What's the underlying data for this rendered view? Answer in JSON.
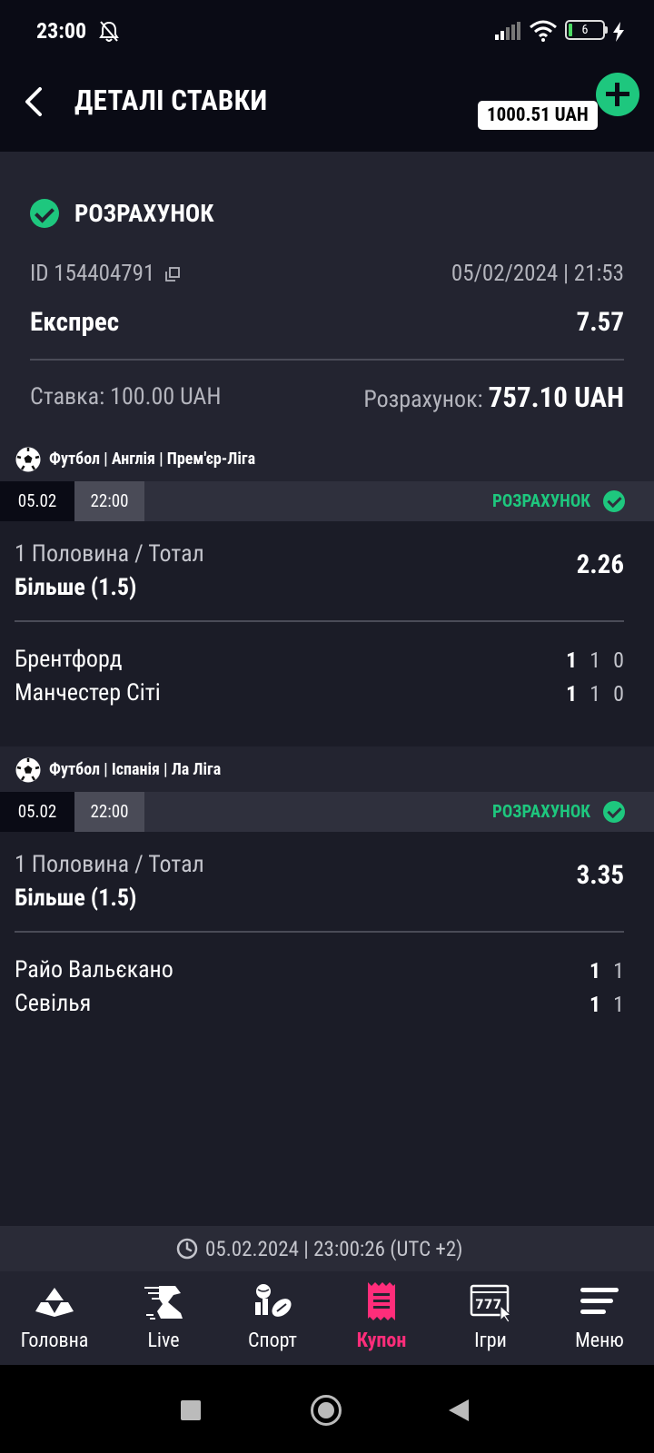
{
  "status_bar": {
    "time": "23:00",
    "battery": "6"
  },
  "header": {
    "title": "ДЕТАЛІ СТАВКИ",
    "balance": "1000.51 UAH"
  },
  "summary": {
    "status": "РОЗРАХУНОК",
    "bet_id": "ID 154404791",
    "datetime": "05/02/2024 | 21:53",
    "bet_type": "Експрес",
    "total_odds": "7.57",
    "stake": "Ставка: 100.00 UAH",
    "payout_label": "Розрахунок:",
    "payout_value": "757.10 UAH"
  },
  "events": [
    {
      "league": "Футбол | Англія | Прем'єр-Ліга",
      "date": "05.02",
      "time": "22:00",
      "status": "РОЗРАХУНОК",
      "market": "1 Половина / Тотал",
      "selection": "Більше (1.5)",
      "odds": "2.26",
      "teams": [
        {
          "name": "Брентфорд",
          "scores": [
            "1",
            "1",
            "0"
          ]
        },
        {
          "name": "Манчестер Сіті",
          "scores": [
            "1",
            "1",
            "0"
          ]
        }
      ]
    },
    {
      "league": "Футбол | Іспанія | Ла Ліга",
      "date": "05.02",
      "time": "22:00",
      "status": "РОЗРАХУНОК",
      "market": "1 Половина / Тотал",
      "selection": "Більше (1.5)",
      "odds": "3.35",
      "teams": [
        {
          "name": "Райо Вальєкано",
          "scores": [
            "1",
            "1"
          ]
        },
        {
          "name": "Севілья",
          "scores": [
            "1",
            "1"
          ]
        }
      ]
    }
  ],
  "server_time": "05.02.2024 | 23:00:26 (UTC +2)",
  "nav": [
    {
      "label": "Головна",
      "icon": "home-icon"
    },
    {
      "label": "Live",
      "icon": "live-icon"
    },
    {
      "label": "Спорт",
      "icon": "sport-icon"
    },
    {
      "label": "Купон",
      "icon": "coupon-icon",
      "active": true
    },
    {
      "label": "Ігри",
      "icon": "games-icon"
    },
    {
      "label": "Меню",
      "icon": "menu-icon"
    }
  ],
  "colors": {
    "accent_green": "#1ec77e",
    "accent_pink": "#ff2d7a",
    "background": "#0a0b15"
  }
}
